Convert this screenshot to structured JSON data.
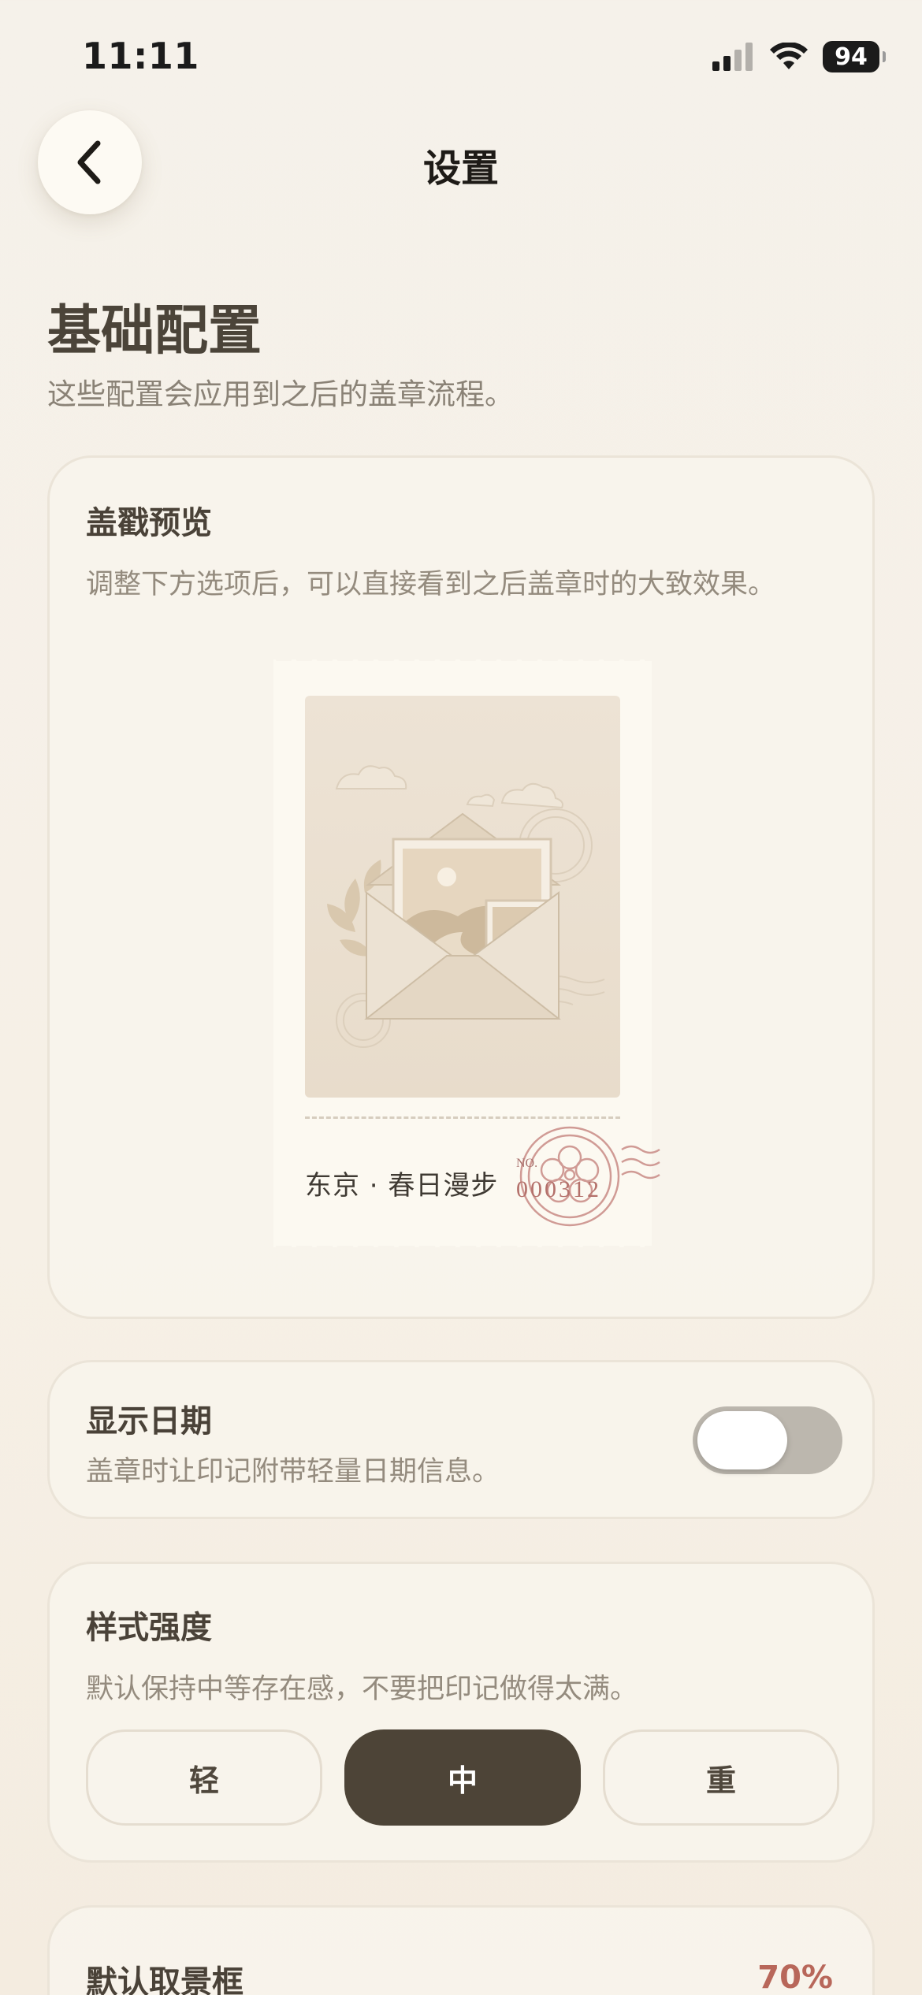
{
  "status_bar": {
    "time": "11:11",
    "battery": "94",
    "icons": [
      "signal-icon",
      "wifi-icon",
      "battery-icon"
    ]
  },
  "header": {
    "title": "设置",
    "back_icon": "chevron-left-icon"
  },
  "section": {
    "title": "基础配置",
    "subtitle": "这些配置会应用到之后的盖章流程。"
  },
  "preview_card": {
    "title": "盖戳预览",
    "description": "调整下方选项后，可以直接看到之后盖章时的大致效果。",
    "stamp": {
      "caption": "东京 · 春日漫步",
      "number_prefix": "NO.",
      "number": "000312"
    }
  },
  "show_date": {
    "title": "显示日期",
    "description": "盖章时让印记附带轻量日期信息。",
    "enabled": false
  },
  "style_intensity": {
    "title": "样式强度",
    "description": "默认保持中等存在感，不要把印记做得太满。",
    "options": [
      "轻",
      "中",
      "重"
    ],
    "selected": "中"
  },
  "viewfinder": {
    "title": "默认取景框",
    "value": "70%"
  },
  "colors": {
    "background": "#f5f1ea",
    "card": "#f8f4ec",
    "accent_dark": "#4d4437",
    "accent_red": "#b8675a",
    "toggle_off": "#bcb7ae"
  }
}
